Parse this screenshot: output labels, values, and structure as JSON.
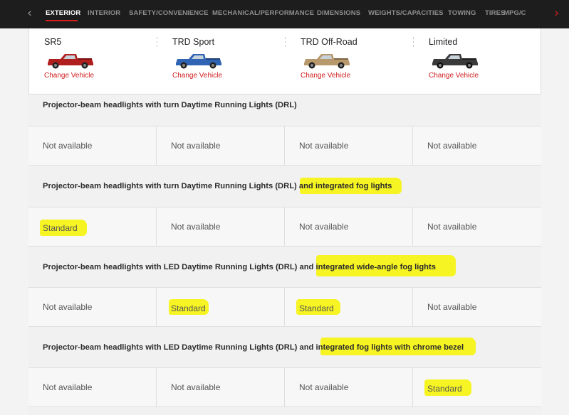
{
  "nav": {
    "left_arrow": "‹",
    "right_arrow": "›",
    "tabs": [
      "EXTERIOR",
      "INTERIOR",
      "SAFETY/CONVENIENCE",
      "MECHANICAL/PERFORMANCE",
      "DIMENSIONS",
      "WEIGHTS/CAPACITIES",
      "TOWING",
      "TIRES",
      "MPG/C"
    ],
    "active_tab": "EXTERIOR",
    "accent_color": "#d51f1f"
  },
  "vehicles": [
    {
      "name": "SR5",
      "change_label": "Change Vehicle",
      "color": "#b11e1e",
      "icon": "red-truck"
    },
    {
      "name": "TRD Sport",
      "change_label": "Change Vehicle",
      "color": "#2f64b5",
      "icon": "blue-truck"
    },
    {
      "name": "TRD Off-Road",
      "change_label": "Change Vehicle",
      "color": "#b8996d",
      "icon": "tan-truck"
    },
    {
      "name": "Limited",
      "change_label": "Change Vehicle",
      "color": "#3a3a3a",
      "icon": "gray-truck"
    }
  ],
  "rows": [
    {
      "desc_plain": "Projector-beam headlights with turn Daytime Running Lights (DRL)",
      "desc_highlight": "",
      "values": [
        "Not available",
        "Not available",
        "Not available",
        "Not available"
      ],
      "value_highlight": [
        false,
        false,
        false,
        false
      ]
    },
    {
      "desc_plain": "Projector-beam headlights with turn Daytime Running Lights (DRL) ",
      "desc_highlight": "and integrated fog lights",
      "values": [
        "Standard",
        "Not available",
        "Not available",
        "Not available"
      ],
      "value_highlight": [
        true,
        false,
        false,
        false
      ]
    },
    {
      "desc_plain": "Projector-beam headlights with LED Daytime Running Lights (DRL) and ",
      "desc_highlight": "integrated wide-angle fog lights",
      "values": [
        "Not available",
        "Standard",
        "Standard",
        "Not available"
      ],
      "value_highlight": [
        false,
        true,
        true,
        false
      ]
    },
    {
      "desc_plain": "Projector-beam headlights with LED Daytime Running Lights (DRL) and ",
      "desc_highlight": "integrated fog lights with chrome bezel",
      "values": [
        "Not available",
        "Not available",
        "Not available",
        "Standard"
      ],
      "value_highlight": [
        false,
        false,
        false,
        true
      ]
    }
  ],
  "highlight_color": "#f6f316"
}
